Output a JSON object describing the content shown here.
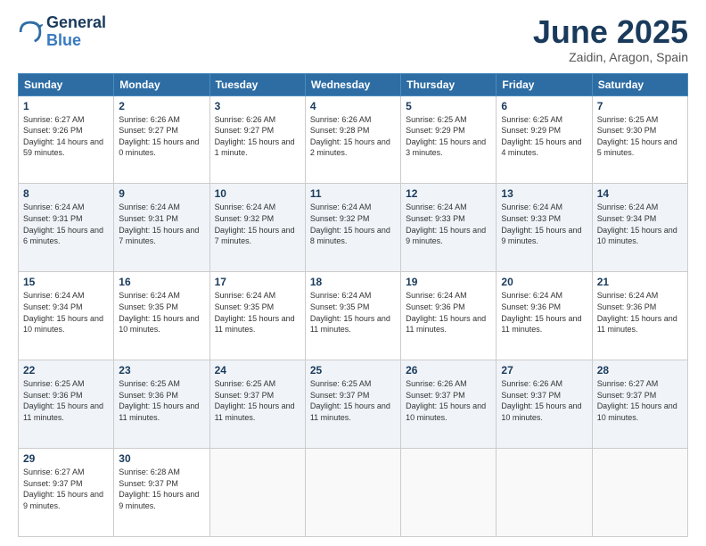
{
  "logo": {
    "line1": "General",
    "line2": "Blue"
  },
  "title": "June 2025",
  "subtitle": "Zaidin, Aragon, Spain",
  "headers": [
    "Sunday",
    "Monday",
    "Tuesday",
    "Wednesday",
    "Thursday",
    "Friday",
    "Saturday"
  ],
  "weeks": [
    [
      {
        "day": "1",
        "sunrise": "6:27 AM",
        "sunset": "9:26 PM",
        "daylight": "14 hours and 59 minutes."
      },
      {
        "day": "2",
        "sunrise": "6:26 AM",
        "sunset": "9:27 PM",
        "daylight": "15 hours and 0 minutes."
      },
      {
        "day": "3",
        "sunrise": "6:26 AM",
        "sunset": "9:27 PM",
        "daylight": "15 hours and 1 minute."
      },
      {
        "day": "4",
        "sunrise": "6:26 AM",
        "sunset": "9:28 PM",
        "daylight": "15 hours and 2 minutes."
      },
      {
        "day": "5",
        "sunrise": "6:25 AM",
        "sunset": "9:29 PM",
        "daylight": "15 hours and 3 minutes."
      },
      {
        "day": "6",
        "sunrise": "6:25 AM",
        "sunset": "9:29 PM",
        "daylight": "15 hours and 4 minutes."
      },
      {
        "day": "7",
        "sunrise": "6:25 AM",
        "sunset": "9:30 PM",
        "daylight": "15 hours and 5 minutes."
      }
    ],
    [
      {
        "day": "8",
        "sunrise": "6:24 AM",
        "sunset": "9:31 PM",
        "daylight": "15 hours and 6 minutes."
      },
      {
        "day": "9",
        "sunrise": "6:24 AM",
        "sunset": "9:31 PM",
        "daylight": "15 hours and 7 minutes."
      },
      {
        "day": "10",
        "sunrise": "6:24 AM",
        "sunset": "9:32 PM",
        "daylight": "15 hours and 7 minutes."
      },
      {
        "day": "11",
        "sunrise": "6:24 AM",
        "sunset": "9:32 PM",
        "daylight": "15 hours and 8 minutes."
      },
      {
        "day": "12",
        "sunrise": "6:24 AM",
        "sunset": "9:33 PM",
        "daylight": "15 hours and 9 minutes."
      },
      {
        "day": "13",
        "sunrise": "6:24 AM",
        "sunset": "9:33 PM",
        "daylight": "15 hours and 9 minutes."
      },
      {
        "day": "14",
        "sunrise": "6:24 AM",
        "sunset": "9:34 PM",
        "daylight": "15 hours and 10 minutes."
      }
    ],
    [
      {
        "day": "15",
        "sunrise": "6:24 AM",
        "sunset": "9:34 PM",
        "daylight": "15 hours and 10 minutes."
      },
      {
        "day": "16",
        "sunrise": "6:24 AM",
        "sunset": "9:35 PM",
        "daylight": "15 hours and 10 minutes."
      },
      {
        "day": "17",
        "sunrise": "6:24 AM",
        "sunset": "9:35 PM",
        "daylight": "15 hours and 11 minutes."
      },
      {
        "day": "18",
        "sunrise": "6:24 AM",
        "sunset": "9:35 PM",
        "daylight": "15 hours and 11 minutes."
      },
      {
        "day": "19",
        "sunrise": "6:24 AM",
        "sunset": "9:36 PM",
        "daylight": "15 hours and 11 minutes."
      },
      {
        "day": "20",
        "sunrise": "6:24 AM",
        "sunset": "9:36 PM",
        "daylight": "15 hours and 11 minutes."
      },
      {
        "day": "21",
        "sunrise": "6:24 AM",
        "sunset": "9:36 PM",
        "daylight": "15 hours and 11 minutes."
      }
    ],
    [
      {
        "day": "22",
        "sunrise": "6:25 AM",
        "sunset": "9:36 PM",
        "daylight": "15 hours and 11 minutes."
      },
      {
        "day": "23",
        "sunrise": "6:25 AM",
        "sunset": "9:36 PM",
        "daylight": "15 hours and 11 minutes."
      },
      {
        "day": "24",
        "sunrise": "6:25 AM",
        "sunset": "9:37 PM",
        "daylight": "15 hours and 11 minutes."
      },
      {
        "day": "25",
        "sunrise": "6:25 AM",
        "sunset": "9:37 PM",
        "daylight": "15 hours and 11 minutes."
      },
      {
        "day": "26",
        "sunrise": "6:26 AM",
        "sunset": "9:37 PM",
        "daylight": "15 hours and 10 minutes."
      },
      {
        "day": "27",
        "sunrise": "6:26 AM",
        "sunset": "9:37 PM",
        "daylight": "15 hours and 10 minutes."
      },
      {
        "day": "28",
        "sunrise": "6:27 AM",
        "sunset": "9:37 PM",
        "daylight": "15 hours and 10 minutes."
      }
    ],
    [
      {
        "day": "29",
        "sunrise": "6:27 AM",
        "sunset": "9:37 PM",
        "daylight": "15 hours and 9 minutes."
      },
      {
        "day": "30",
        "sunrise": "6:28 AM",
        "sunset": "9:37 PM",
        "daylight": "15 hours and 9 minutes."
      },
      null,
      null,
      null,
      null,
      null
    ]
  ]
}
